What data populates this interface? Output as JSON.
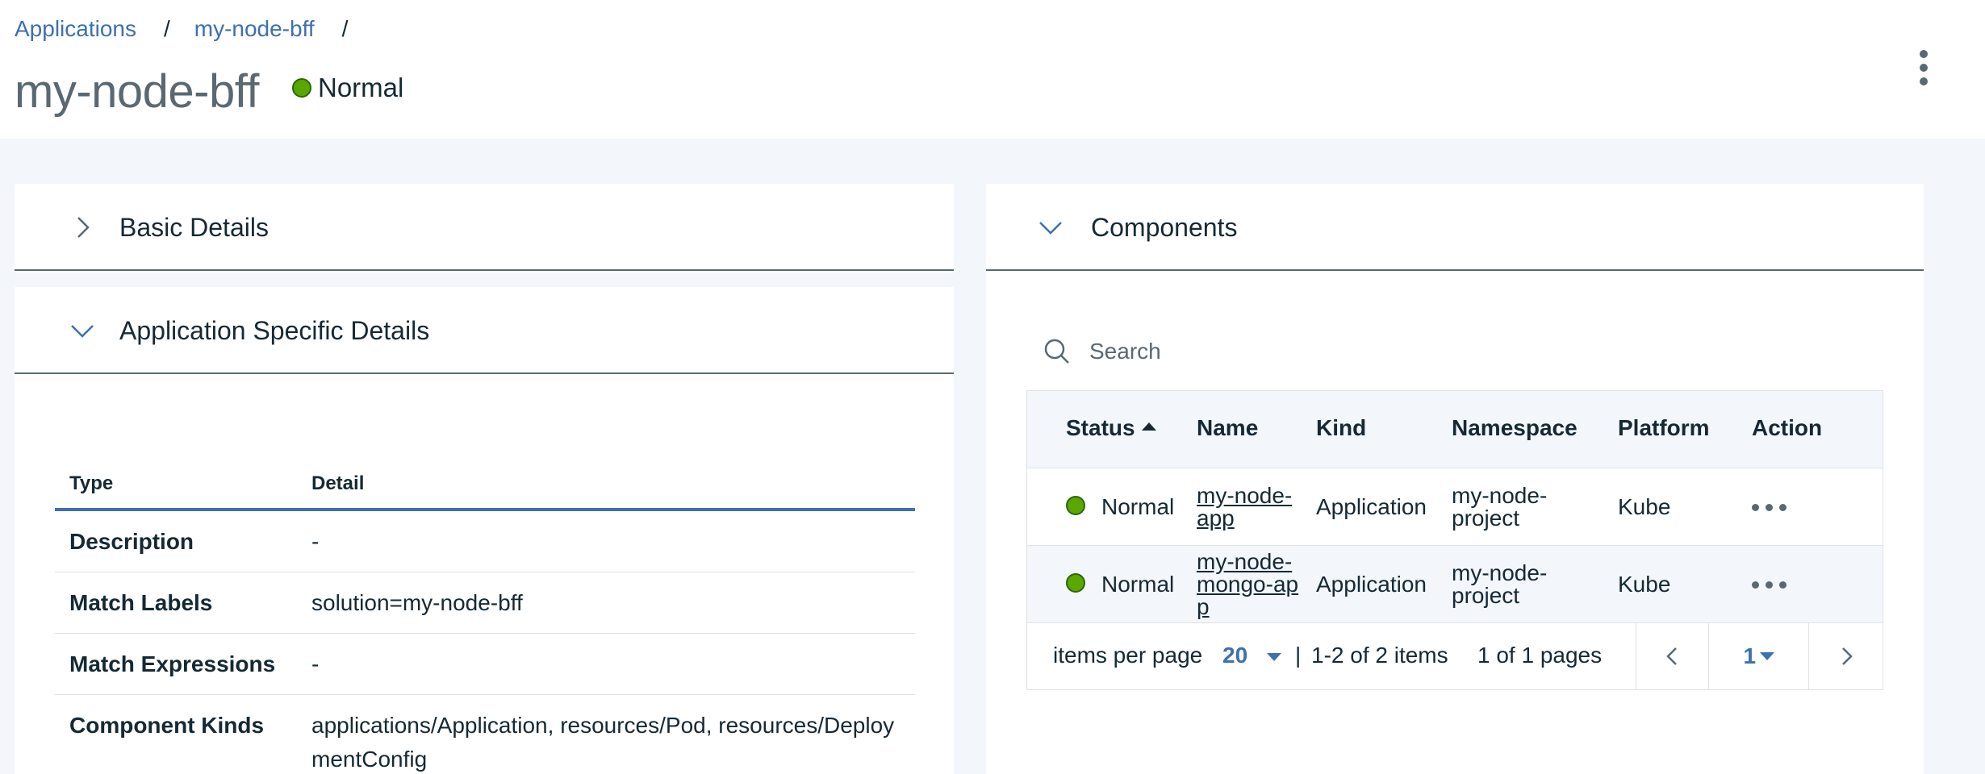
{
  "breadcrumb": {
    "items": [
      "Applications",
      "my-node-bff"
    ],
    "separator": "/"
  },
  "page": {
    "title": "my-node-bff",
    "status": "Normal",
    "status_color": "#5aa700"
  },
  "left": {
    "basic_details": {
      "title": "Basic Details",
      "expanded": false
    },
    "app_specific": {
      "title": "Application Specific Details",
      "expanded": true,
      "columns": [
        "Type",
        "Detail"
      ],
      "rows": [
        {
          "type": "Description",
          "detail": "-"
        },
        {
          "type": "Match Labels",
          "detail": "solution=my-node-bff"
        },
        {
          "type": "Match Expressions",
          "detail": "-"
        },
        {
          "type": "Component Kinds",
          "detail": "applications/Application, resources/Pod, resources/DeploymentConfig"
        }
      ]
    }
  },
  "components": {
    "title": "Components",
    "expanded": true,
    "search_placeholder": "Search",
    "columns": [
      "Status",
      "Name",
      "Kind",
      "Namespace",
      "Platform",
      "Action"
    ],
    "rows": [
      {
        "status": "Normal",
        "name": "my-node-app",
        "kind": "Application",
        "namespace": "my-node-project",
        "platform": "Kube"
      },
      {
        "status": "Normal",
        "name": "my-node-mongo-app",
        "kind": "Application",
        "namespace": "my-node-project",
        "platform": "Kube"
      }
    ],
    "pagination": {
      "items_per_page_label": "items per page",
      "items_per_page": "20",
      "range": "1-2 of 2 items",
      "pages": "1 of 1 pages",
      "current_page": "1"
    }
  },
  "colors": {
    "link": "#3d70b2",
    "status_normal": "#5aa700",
    "background": "#f3f6fa"
  }
}
